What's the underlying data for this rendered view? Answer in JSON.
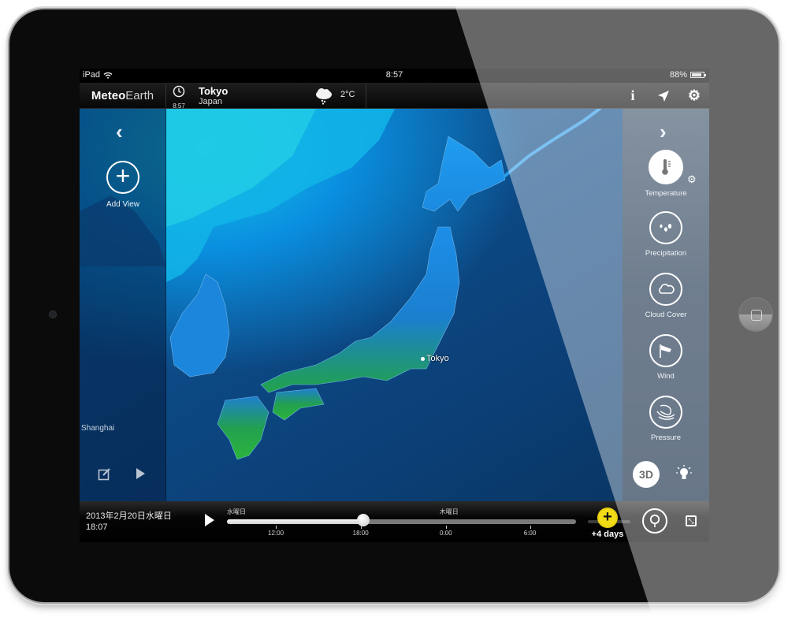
{
  "status_bar": {
    "device": "iPad",
    "wifi_icon": "wifi-icon",
    "time": "8:57",
    "battery": "88%",
    "battery_level": 0.88
  },
  "navbar": {
    "app_name_bold": "Meteo",
    "app_name_light": "Earth",
    "location": {
      "local_time": "8:57",
      "city": "Tokyo",
      "country": "Japan",
      "weather_icon": "cloud-snow-icon",
      "temperature": "2°C"
    },
    "actions": [
      {
        "name": "info-button",
        "icon": "i"
      },
      {
        "name": "locate-button",
        "icon": "➤"
      },
      {
        "name": "settings-button",
        "icon": "⚙"
      }
    ]
  },
  "left_panel": {
    "add_view_label": "Add View",
    "map_labels": {
      "shanghai": "Shanghai"
    }
  },
  "map": {
    "city_label": "Tokyo"
  },
  "right_panel": {
    "layers": [
      {
        "label": "Temperature",
        "icon": "thermometer-icon",
        "active": true
      },
      {
        "label": "Precipitation",
        "icon": "raindrops-icon",
        "active": false
      },
      {
        "label": "Cloud Cover",
        "icon": "cloud-icon",
        "active": false
      },
      {
        "label": "Wind",
        "icon": "windsock-icon",
        "active": false
      },
      {
        "label": "Pressure",
        "icon": "isobars-icon",
        "active": false
      }
    ],
    "btn_3d": "3D"
  },
  "timeline": {
    "date": "2013年2月20日水曜日",
    "time": "18:07",
    "progress": 0.39,
    "day_labels": [
      {
        "text": "水曜日",
        "pos": 0.0
      },
      {
        "text": "木曜日",
        "pos": 0.627
      }
    ],
    "ticks": [
      {
        "label": "12:00",
        "pos": 0.14
      },
      {
        "label": "18:00",
        "pos": 0.383
      },
      {
        "label": "0:00",
        "pos": 0.627
      },
      {
        "label": "6:00",
        "pos": 0.868
      }
    ],
    "more_days": "+4 days"
  }
}
